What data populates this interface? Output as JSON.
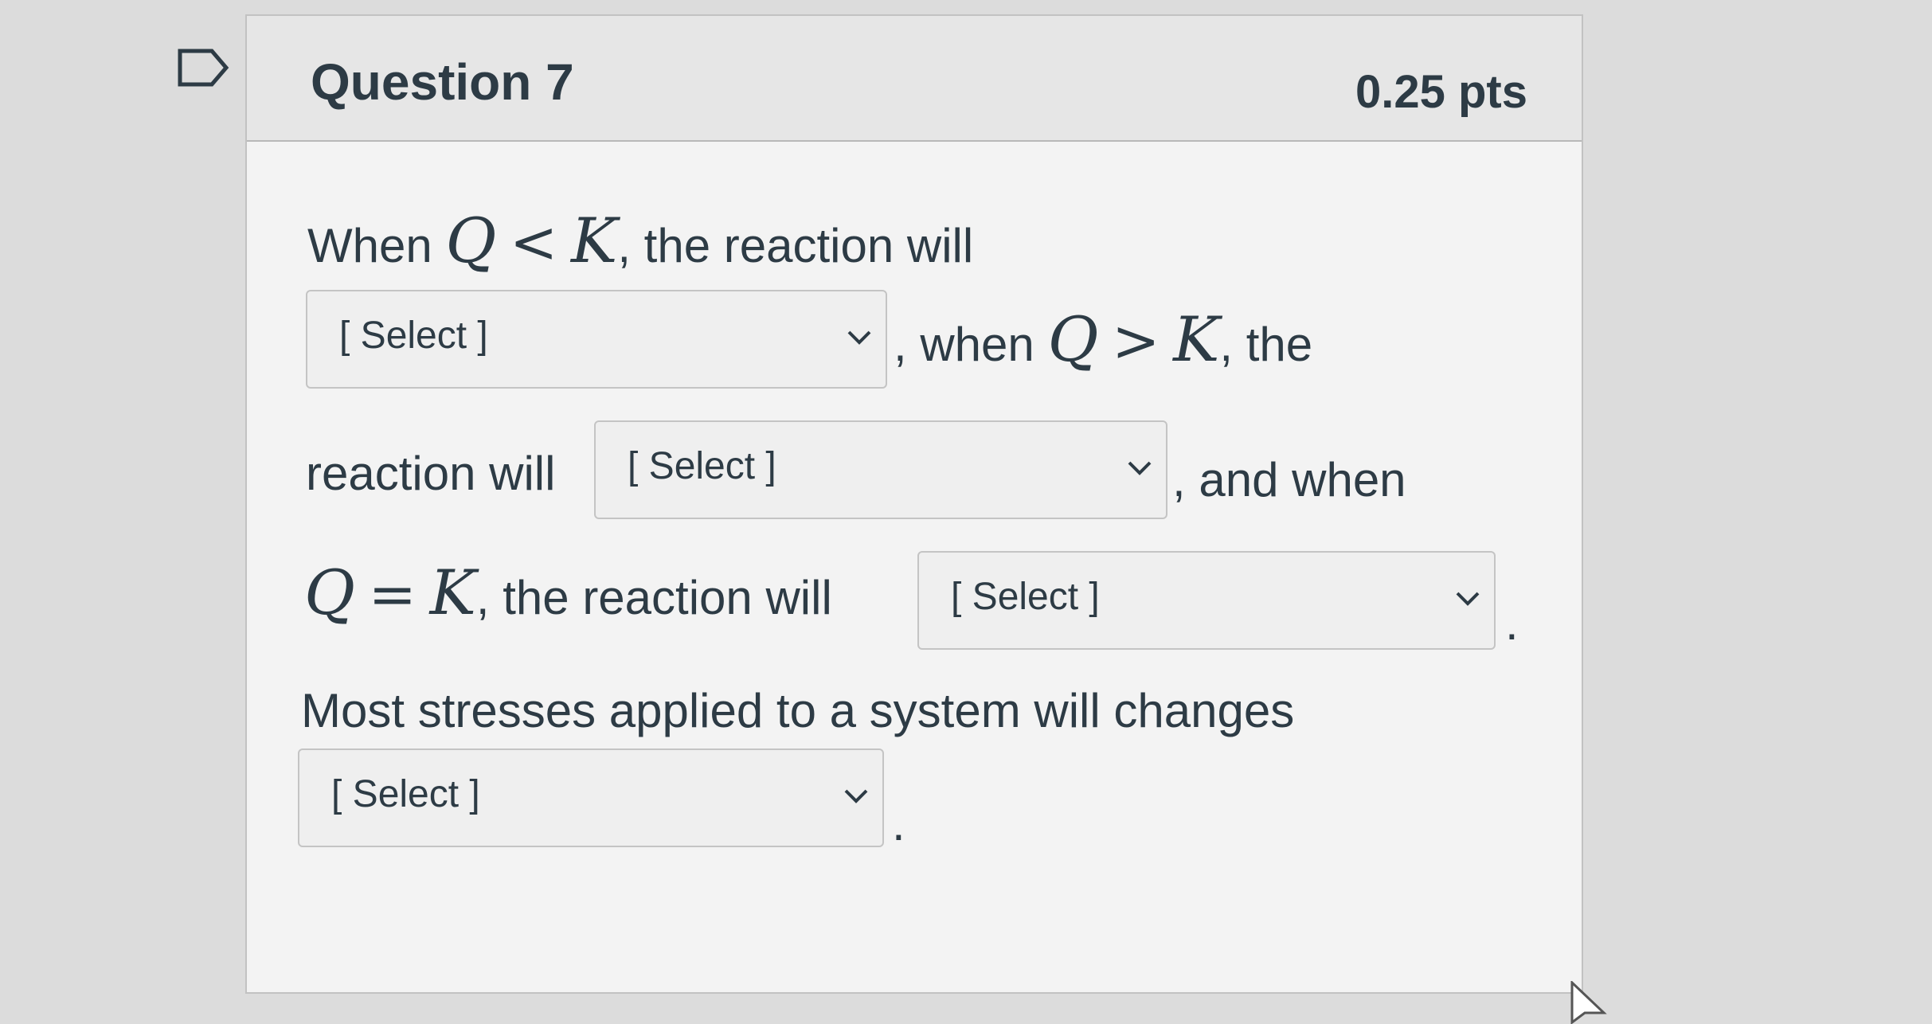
{
  "question": {
    "title": "Question 7",
    "points": "0.25 pts"
  },
  "body": {
    "when": "When",
    "q": "Q",
    "k": "K",
    "lt": "<",
    "gt": ">",
    "eq": "=",
    "line1_tail": ", the reaction will",
    "when2": ", when",
    "the": ", the",
    "reaction_will": "reaction will",
    "and_when": ", and when",
    "line4_tail": ", the reaction will",
    "period": ".",
    "stresses_text": "Most stresses applied to a system will changes"
  },
  "selects": [
    {
      "value": "[ Select ]"
    },
    {
      "value": "[ Select ]"
    },
    {
      "value": "[ Select ]"
    },
    {
      "value": "[ Select ]"
    }
  ],
  "icons": {
    "flag": "bookmark-flag-icon",
    "chevron": "chevron-down-icon",
    "cursor": "mouse-pointer-icon"
  }
}
